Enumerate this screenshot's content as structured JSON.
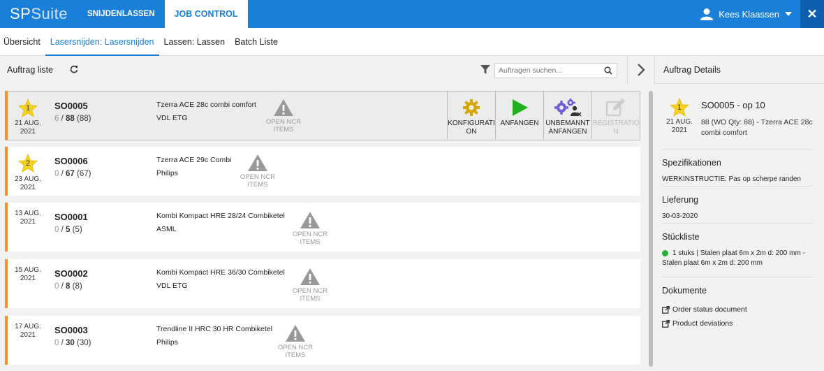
{
  "header": {
    "logo_sp": "SP",
    "logo_suite": "Suite",
    "tabs": [
      {
        "label": "SNIJDENLASSEN",
        "active": false
      },
      {
        "label": "JOB CONTROL",
        "active": true
      }
    ],
    "user_name": "Kees Klaassen",
    "close_label": "✕"
  },
  "subnav": [
    {
      "label": "Übersicht",
      "active": false
    },
    {
      "label": "Lasersnijden: Lasersnijden",
      "active": true
    },
    {
      "label": "Lassen: Lassen",
      "active": false
    },
    {
      "label": "Batch Liste",
      "active": false
    }
  ],
  "list": {
    "title": "Auftrag liste",
    "search_placeholder": "Auftragen suchen...",
    "ncr_line1": "OPEN NCR",
    "ncr_line2": "ITEMS",
    "actions": [
      {
        "label": "KONFIGURATION",
        "line1": "KONFIGURATI",
        "line2": "ON",
        "icon": "gear-icon",
        "color": "#d4a800",
        "disabled": false
      },
      {
        "label": "ANFANGEN",
        "line1": "ANFANGEN",
        "line2": "",
        "icon": "play-icon",
        "color": "#1fb11f",
        "disabled": false
      },
      {
        "label": "UNBEMANNT ANFANGEN",
        "line1": "UNBEMANNT",
        "line2": "ANFANGEN",
        "icon": "unmanned-gears-icon",
        "color": "#6f5cd6",
        "disabled": false
      },
      {
        "label": "REGISTRATION",
        "line1": "REGISTRATIO",
        "line2": "N",
        "icon": "edit-icon",
        "color": "#cccccc",
        "disabled": true
      }
    ],
    "orders": [
      {
        "priority": "1",
        "date_day": "21 AUG.",
        "date_year": "2021",
        "so": "SO0005",
        "done": "6",
        "total": "88",
        "paren": "(88)",
        "product": "Tzerra ACE 28c combi comfort",
        "customer": "VDL ETG",
        "selected": true
      },
      {
        "priority": "2",
        "date_day": "23 AUG.",
        "date_year": "2021",
        "so": "SO0006",
        "done": "0",
        "total": "67",
        "paren": "(67)",
        "product": "Tzerra ACE 29c Combi",
        "customer": "Philips",
        "selected": false
      },
      {
        "priority": "",
        "date_day": "13 AUG.",
        "date_year": "2021",
        "so": "SO0001",
        "done": "0",
        "total": "5",
        "paren": "(5)",
        "product": "Kombi Kompact HRE 28/24 Combiketel",
        "customer": "ASML",
        "selected": false
      },
      {
        "priority": "",
        "date_day": "15 AUG.",
        "date_year": "2021",
        "so": "SO0002",
        "done": "0",
        "total": "8",
        "paren": "(8)",
        "product": "Kombi Kompact HRE 36/30 Combiketel",
        "customer": "VDL ETG",
        "selected": false
      },
      {
        "priority": "",
        "date_day": "17 AUG.",
        "date_year": "2021",
        "so": "SO0003",
        "done": "0",
        "total": "30",
        "paren": "(30)",
        "product": "Trendline II HRC 30 HR Combiketel",
        "customer": "Philips",
        "selected": false
      }
    ]
  },
  "details": {
    "title": "Auftrag Details",
    "priority": "1",
    "date_day": "21 AUG.",
    "date_year": "2021",
    "so_title": "SO0005 - op 10",
    "subtitle": "88 (WO Qty: 88) - Tzerra ACE 28c combi comfort",
    "spec_title": "Spezifikationen",
    "spec_text": "WERKINSTRUCTIE: Pas op scherpe randen",
    "delivery_title": "Lieferung",
    "delivery_date": "30-03-2020",
    "bom_title": "Stückliste",
    "bom_item": "1 stuks | Stalen plaat 6m x 2m d: 200 mm - Stalen plaat 6m x 2m d: 200 mm",
    "bom_status_color": "#22b534",
    "docs_title": "Dokumente",
    "docs": [
      "Order status document",
      "Product deviations"
    ]
  },
  "colors": {
    "brand": "#1a7fd9",
    "order_accent": "#f0922b",
    "star": "#f5d21c"
  }
}
